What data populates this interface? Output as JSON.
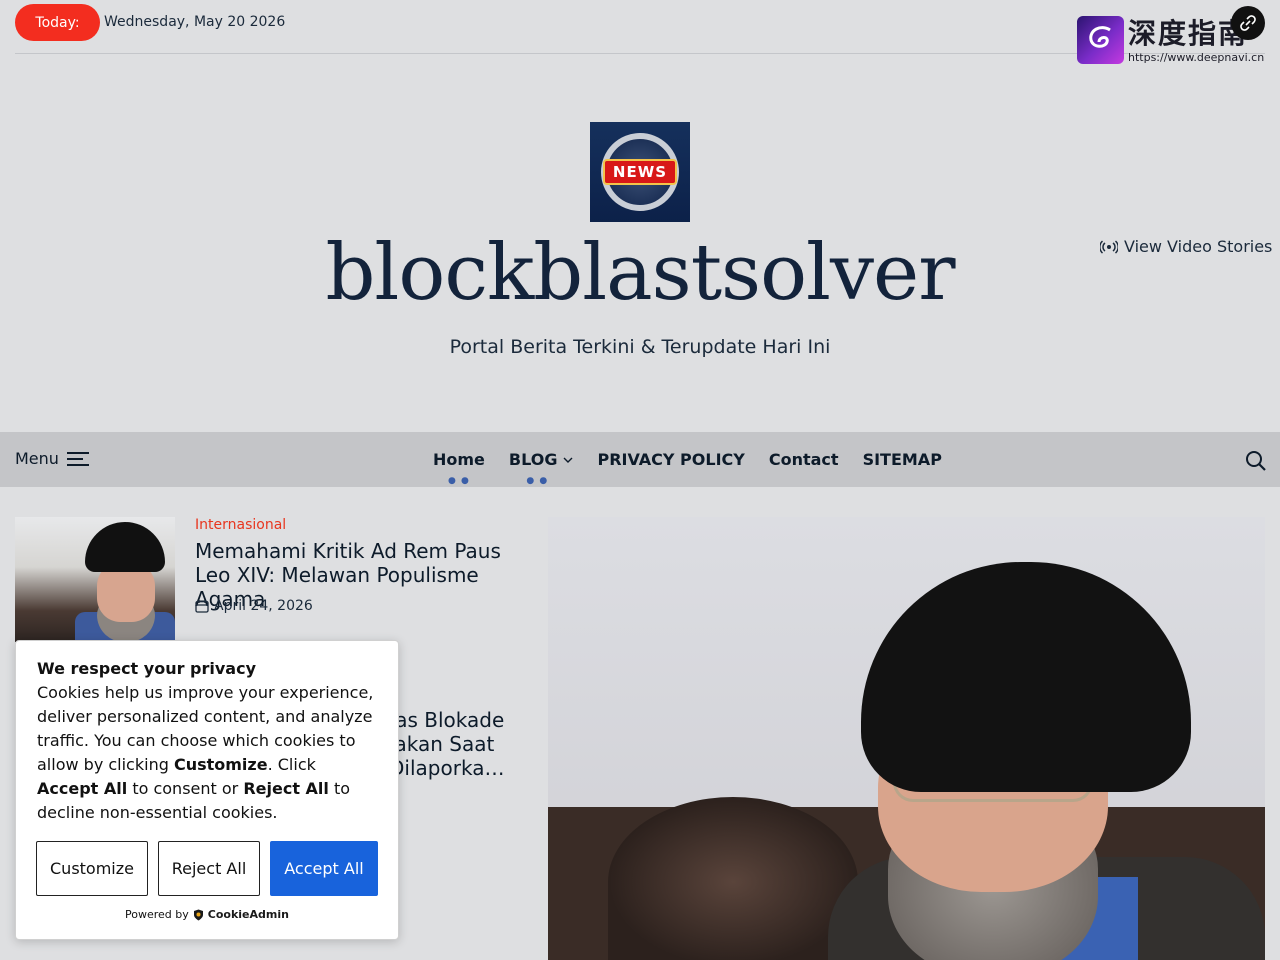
{
  "topbar": {
    "today_label": "Today:",
    "date": "Wednesday, May 20 2026"
  },
  "watermark": {
    "title": "深度指南",
    "url": "https://www.deepnavi.cn"
  },
  "header": {
    "logo_text": "NEWS",
    "site_title": "blockblastsolver",
    "tagline": "Portal Berita Terkini & Terupdate Hari Ini",
    "video_stories": "View Video Stories"
  },
  "nav": {
    "menu_label": "Menu",
    "items": [
      {
        "label": "Home"
      },
      {
        "label": "BLOG"
      },
      {
        "label": "PRIVACY POLICY"
      },
      {
        "label": "Contact"
      },
      {
        "label": "SITEMAP"
      }
    ]
  },
  "articles": [
    {
      "category": "Internasional",
      "title": "Memahami Kritik Ad Rem Paus Leo XIV: Melawan Populisme Agama",
      "date": "April 24, 2026"
    },
    {
      "title_visible": "vitas Blokade\nnyakan Saat\nn Dilaporka…"
    }
  ],
  "cookie": {
    "title": "We respect your privacy",
    "body_part1": "Cookies help us improve your experience, deliver personalized content, and analyze traffic. You can choose which cookies to allow by clicking ",
    "customize_word": "Customize",
    "body_part2": ". Click ",
    "accept_words": "Accept All",
    "body_part3": " to consent or ",
    "reject_words": "Reject All",
    "body_part4": " to decline non-essential cookies.",
    "buttons": {
      "customize": "Customize",
      "reject": "Reject All",
      "accept": "Accept All"
    },
    "powered_by": "Powered by",
    "powered_brand": "CookieAdmin"
  },
  "colors": {
    "accent_red": "#f32d1f",
    "accept_blue": "#1863dc",
    "nav_bg": "#c4c5c8",
    "page_bg": "#dedfe1"
  }
}
